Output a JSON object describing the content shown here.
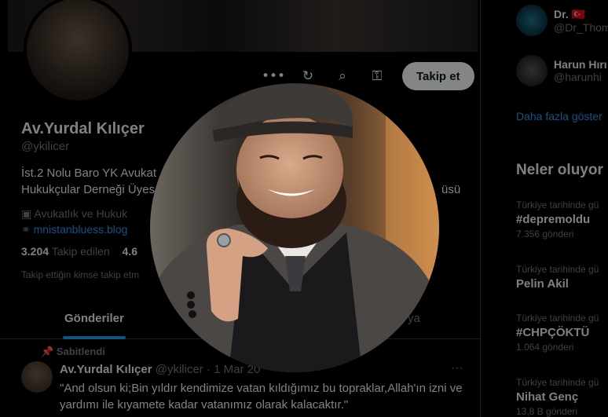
{
  "profile": {
    "name": "Av.Yurdal Kılıçer",
    "handle": "@ykilicer",
    "bio_line1": "İst.2 Nolu Baro YK Avukat",
    "bio_line2": "Hukukçular Derneği Üyes",
    "bio_tail": "üsü",
    "job": "Avukatlık ve Hukuk",
    "website": "mnistanbluess.blog",
    "following_count": "3.204",
    "following_label": "Takip edilen",
    "followers_count": "4.6",
    "followed_by_note": "Takip ettiğin kimse takip etm"
  },
  "actions": {
    "more_icon": "•••",
    "subscribe_icon": "↻",
    "search_icon": "⌕",
    "gift_icon": "⚿",
    "follow_label": "Takip et"
  },
  "tabs": [
    {
      "label": "Gönderiler",
      "active": true
    },
    {
      "label": "ya",
      "active": false
    }
  ],
  "pinned_label": "Sabitlendi",
  "tweet": {
    "name": "Av.Yurdal Kılıçer",
    "meta": "@ykilicer · 1 Mar 20",
    "more": "···",
    "text": "\"And olsun ki;Bin yıldır kendimize vatan kıldığımız bu topraklar,Allah'ın izni ve yardımı ile kıyamete kadar vatanımız olarak kalacaktır.\""
  },
  "sidebar": {
    "who_to_follow": [
      {
        "name": "Dr. 🇹🇷",
        "handle": "@Dr_Thoma"
      },
      {
        "name": "Harun Hırı",
        "handle": "@harunhi"
      }
    ],
    "show_more": "Daha fazla göster",
    "trends_title": "Neler oluyor",
    "trends": [
      {
        "context": "Türkiye tarihinde gü",
        "title": "#depremoldu",
        "count": "7.356 gönderi"
      },
      {
        "context": "Türkiye tarihinde gü",
        "title": "Pelin Akil",
        "count": ""
      },
      {
        "context": "Türkiye tarihinde gü",
        "title": "#CHPÇÖKTÜ",
        "count": "1.064 gönderi"
      },
      {
        "context": "Türkiye tarihinde gü",
        "title": "Nihat Genç",
        "count": "13,8 B gönderi"
      }
    ]
  },
  "colors": {
    "accent": "#1d9bf0",
    "background": "#000000",
    "muted_text": "#71767b"
  }
}
